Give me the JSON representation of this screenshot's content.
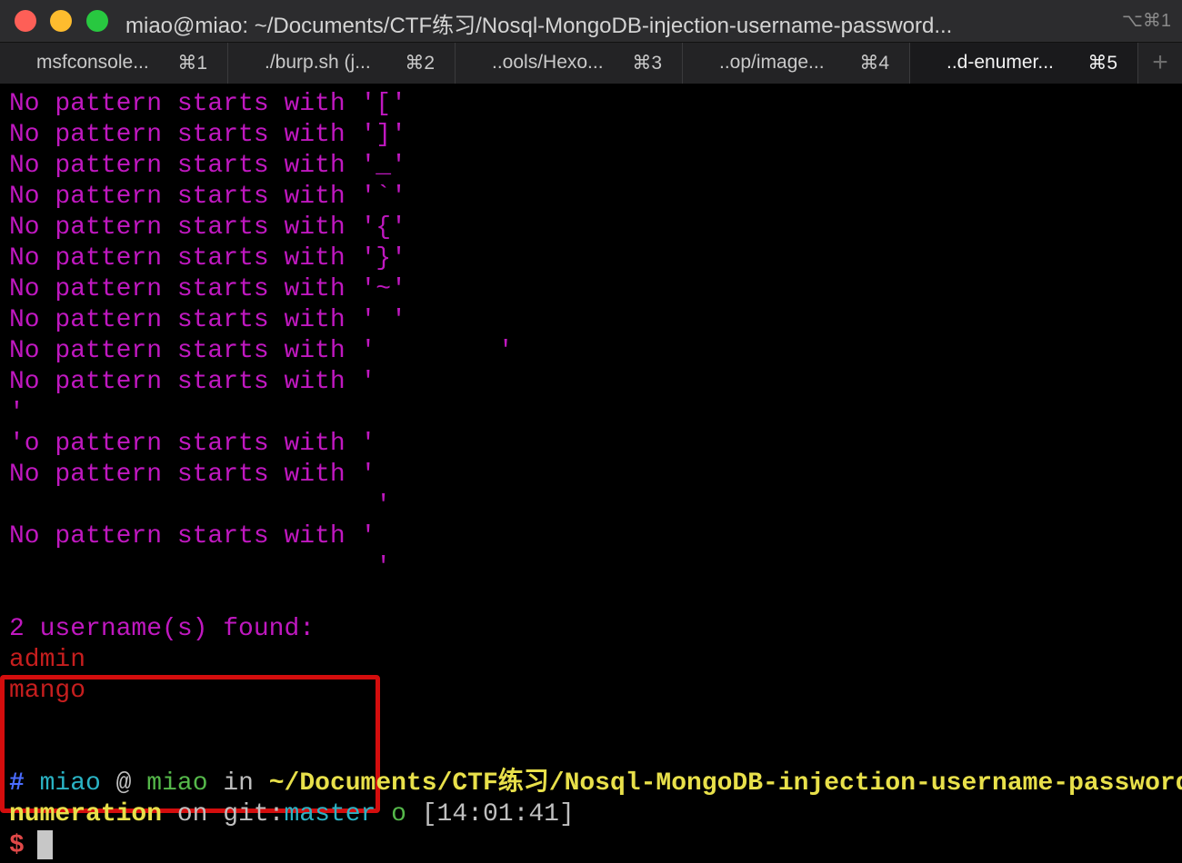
{
  "window": {
    "title": "miao@miao: ~/Documents/CTF练习/Nosql-MongoDB-injection-username-password...",
    "shortcut": "⌥⌘1"
  },
  "tabs": [
    {
      "label": "msfconsole...",
      "shortcut": "⌘1"
    },
    {
      "label": "./burp.sh (j...",
      "shortcut": "⌘2"
    },
    {
      "label": "..ools/Hexo...",
      "shortcut": "⌘3"
    },
    {
      "label": "..op/image...",
      "shortcut": "⌘4"
    },
    {
      "label": "..d-enumer...",
      "shortcut": "⌘5"
    }
  ],
  "new_tab_label": "+",
  "output_lines": [
    "No pattern starts with '['",
    "No pattern starts with ']'",
    "No pattern starts with '_'",
    "No pattern starts with '`'",
    "No pattern starts with '{'",
    "No pattern starts with '}'",
    "No pattern starts with '~'",
    "No pattern starts with ' '",
    "No pattern starts with '        '",
    "No pattern starts with '",
    "'",
    "'o pattern starts with '",
    "No pattern starts with '",
    "                        '",
    "",
    "No pattern starts with '",
    "                        '"
  ],
  "result": {
    "header": "2 username(s) found:",
    "usernames": [
      "admin",
      "mango"
    ]
  },
  "prompt": {
    "hash": "#",
    "user": "miao",
    "at": "@",
    "host": "miao",
    "in": "in",
    "path_line1": "~/Documents/CTF练习/Nosql-MongoDB-injection-username-password-e",
    "path_line2": "numeration",
    "on": "on",
    "git": "git:",
    "branch": "master",
    "status": "o",
    "time": "[14:01:41]",
    "dollar": "$"
  }
}
